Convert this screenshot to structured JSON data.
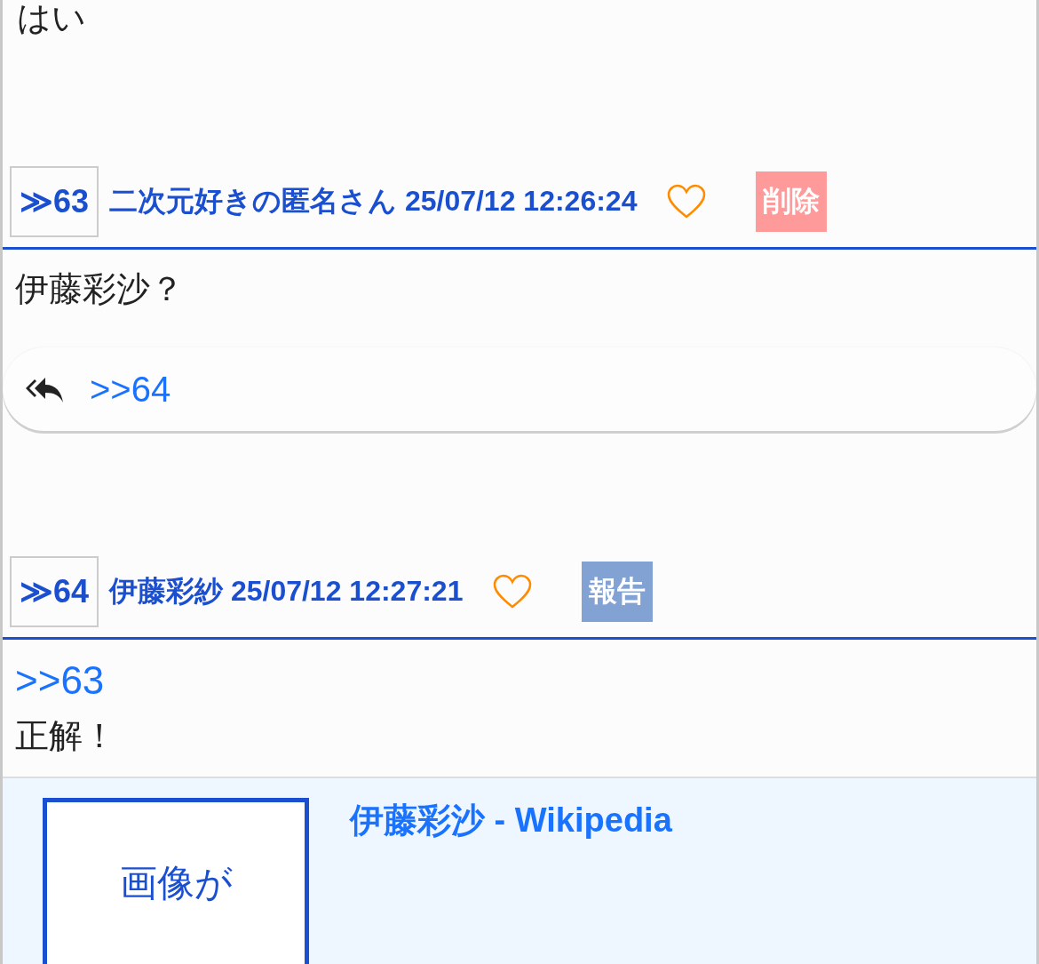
{
  "previous_post": {
    "body": [
      "はい"
    ]
  },
  "posts": [
    {
      "number": "≫63",
      "name": "二次元好きの匿名さん",
      "date": "25/07/12 12:26:24",
      "liked": false,
      "action": {
        "kind": "delete",
        "label": "削除"
      },
      "body": [
        {
          "kind": "text",
          "text": "伊藤彩沙？"
        }
      ],
      "reply": {
        "anchor": ">>64"
      }
    },
    {
      "number": "≫64",
      "name": "伊藤彩紗",
      "date": "25/07/12 12:27:21",
      "liked": false,
      "action": {
        "kind": "report",
        "label": "報告"
      },
      "body": [
        {
          "kind": "anchor",
          "text": ">>63"
        },
        {
          "kind": "text",
          "text": "正解！"
        }
      ],
      "link_card": {
        "title": "伊藤彩沙 - Wikipedia",
        "thumbnail_text": "画像が"
      }
    }
  ]
}
